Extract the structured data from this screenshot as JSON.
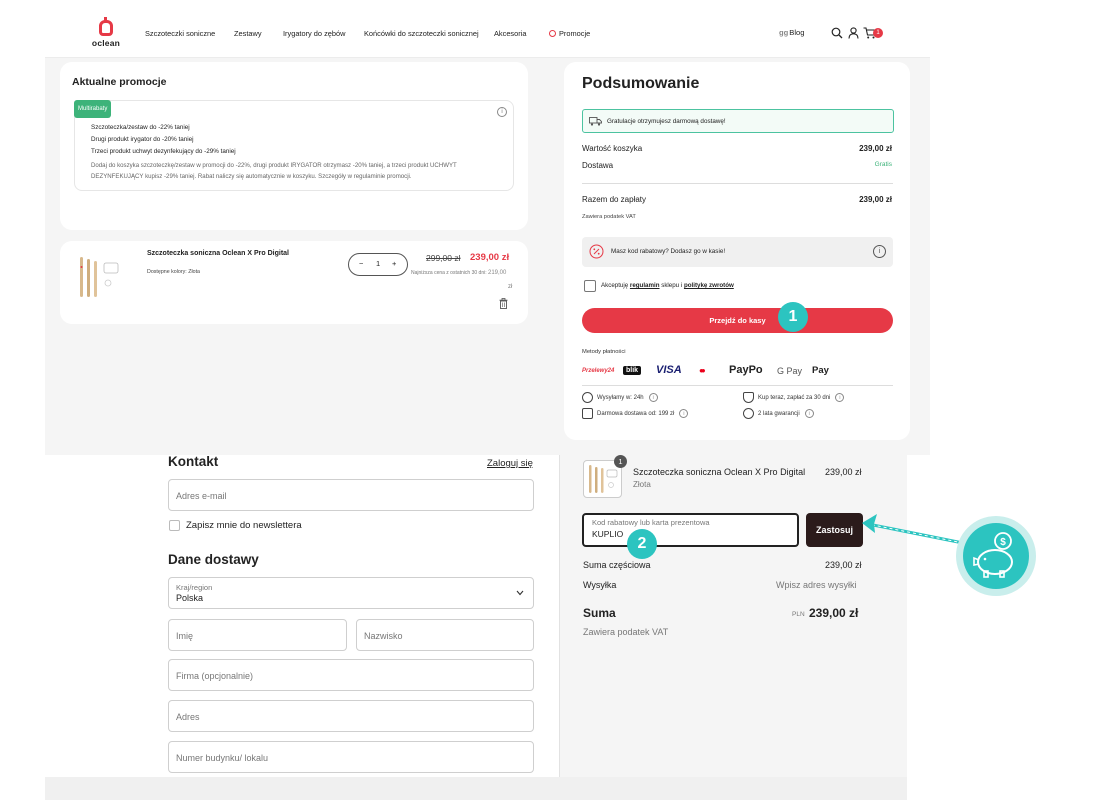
{
  "nav": {
    "logo": "oclean",
    "items": [
      "Szczoteczki soniczne",
      "Zestawy",
      "Irygatory do zębów",
      "Końcówki do szczoteczki sonicznej",
      "Akcesoria",
      "Promocje"
    ],
    "blog_mark": "gg",
    "blog": "Blog",
    "cart_count": "1"
  },
  "promo": {
    "title": "Aktualne promocje",
    "badge": "Multirabaty",
    "lines": [
      "Szczoteczka/zestaw do -22% taniej",
      "Drugi produkt irygator do -20% taniej",
      "Trzeci produkt uchwyt dezynfekujący do -29% taniej"
    ],
    "description": "Dodaj do koszyka szczoteczkę/zestaw w promocji do -22%, drugi produkt IRYGATOR otrzymasz -20% taniej, a trzeci produkt UCHWYT DEZYNFEKUJĄCY kupisz -29% taniej. Rabat naliczy się automatycznie w koszyku. Szczegóły w regulaminie promocji."
  },
  "cart_item": {
    "title": "Szczoteczka soniczna Oclean X Pro Digital",
    "color": "Dostępne kolory: Złota",
    "qty": "1",
    "minus": "−",
    "plus": "+",
    "old_price": "299,00 zł",
    "new_price": "239,00 zł",
    "lowest_label": "Najniższa cena z ostatnich 30 dni:",
    "lowest_price": "219,00",
    "lowest_currency": "zł"
  },
  "summary": {
    "title": "Podsumowanie",
    "free_shipping": "Gratulacje otrzymujesz darmową dostawę!",
    "cart_value_label": "Wartość koszyka",
    "cart_value": "239,00 zł",
    "delivery_label": "Dostawa",
    "delivery_value": "Gratis",
    "total_label": "Razem do zapłaty",
    "total_value": "239,00 zł",
    "vat": "Zawiera podatek VAT",
    "coupon_hint": "Masz kod rabatowy? Dodasz go w kasie!",
    "accept_prefix": "Akceptuję",
    "accept_terms": "regulamin",
    "accept_mid": "sklepu i",
    "accept_returns": "politykę zwrotów",
    "checkout_button": "Przejdź do kasy",
    "step1": "1",
    "payments_label": "Metody płatności",
    "payments": [
      "Przelewy24",
      "blik",
      "VISA",
      "●●",
      "PayPo",
      "G Pay",
      " Pay"
    ],
    "info": [
      "Wysyłamy w: 24h",
      "Kup teraz, zapłać za 30 dni",
      "Darmowa dostawa od: 199 zł",
      "2 lata gwarancji"
    ]
  },
  "checkout": {
    "contact_title": "Kontakt",
    "login_link": "Zaloguj się",
    "email_placeholder": "Adres e-mail",
    "newsletter": "Zapisz mnie do newslettera",
    "delivery_title": "Dane dostawy",
    "country_label": "Kraj/region",
    "country_value": "Polska",
    "first_name": "Imię",
    "last_name": "Nazwisko",
    "company": "Firma (opcjonalnie)",
    "address": "Adres",
    "building": "Numer budynku/ lokalu"
  },
  "order": {
    "badge": "1",
    "product": "Szczoteczka soniczna Oclean X Pro Digital",
    "variant": "Złota",
    "price": "239,00 zł",
    "code_label": "Kod rabatowy lub karta prezentowa",
    "code_value": "KUPLIO",
    "apply_button": "Zastosuj",
    "step2": "2",
    "subtotal_label": "Suma częściowa",
    "subtotal_value": "239,00 zł",
    "shipping_label": "Wysyłka",
    "shipping_value": "Wpisz adres wysyłki",
    "total_label": "Suma",
    "total_currency": "PLN",
    "total_value": "239,00 zł",
    "vat": "Zawiera podatek VAT"
  },
  "colors": {
    "accent_red": "#e63946",
    "step_teal": "#2cc4c0",
    "apply_dark": "#2b1b1b",
    "free_ship_green": "#4cc3a0"
  }
}
